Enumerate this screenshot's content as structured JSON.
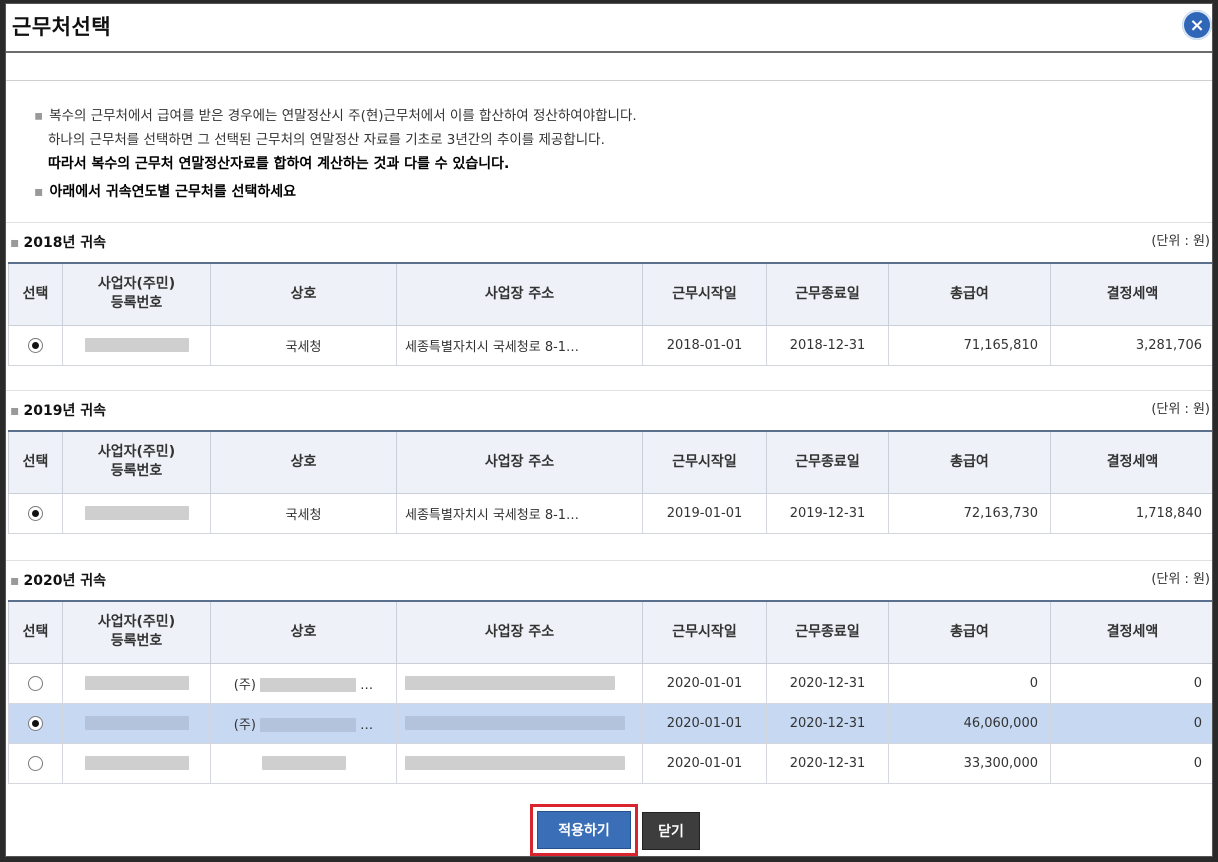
{
  "window": {
    "title": "근무처선택",
    "close_label": "×"
  },
  "notice": {
    "line1": "복수의 근무처에서 급여를 받은 경우에는 연말정산시 주(현)근무처에서 이를 합산하여 정산하여야합니다.",
    "line2": "하나의 근무처를 선택하면 그 선택된 근무처의 연말정산 자료를 기초로 3년간의 추이를 제공합니다.",
    "line3": "따라서 복수의 근무처 연말정산자료를 합하여 계산하는 것과 다를 수 있습니다.",
    "line4": "아래에서 귀속연도별 근무처를 선택하세요"
  },
  "columns": {
    "select": "선택",
    "biz_no_line1": "사업자(주민)",
    "biz_no_line2": "등록번호",
    "company": "상호",
    "address": "사업장 주소",
    "start": "근무시작일",
    "end": "근무종료일",
    "total_pay": "총급여",
    "tax": "결정세액"
  },
  "unit_label": "(단위 : 원)",
  "sections": [
    {
      "title": "2018년 귀속",
      "rows": [
        {
          "selected": true,
          "company": "국세청",
          "address": "세종특별자치시 국세청로 8-1…",
          "start": "2018-01-01",
          "end": "2018-12-31",
          "total_pay": "71,165,810",
          "tax": "3,281,706"
        }
      ]
    },
    {
      "title": "2019년 귀속",
      "rows": [
        {
          "selected": true,
          "company": "국세청",
          "address": "세종특별자치시 국세청로 8-1…",
          "start": "2019-01-01",
          "end": "2019-12-31",
          "total_pay": "72,163,730",
          "tax": "1,718,840"
        }
      ]
    },
    {
      "title": "2020년 귀속",
      "rows": [
        {
          "selected": false,
          "company": "(주)",
          "address": "",
          "start": "2020-01-01",
          "end": "2020-12-31",
          "total_pay": "0",
          "tax": "0"
        },
        {
          "selected": true,
          "company": "(주)",
          "address": "",
          "start": "2020-01-01",
          "end": "2020-12-31",
          "total_pay": "46,060,000",
          "tax": "0"
        },
        {
          "selected": false,
          "company": "",
          "address": "",
          "start": "2020-01-01",
          "end": "2020-12-31",
          "total_pay": "33,300,000",
          "tax": "0"
        }
      ]
    }
  ],
  "buttons": {
    "apply": "적용하기",
    "close": "닫기"
  }
}
